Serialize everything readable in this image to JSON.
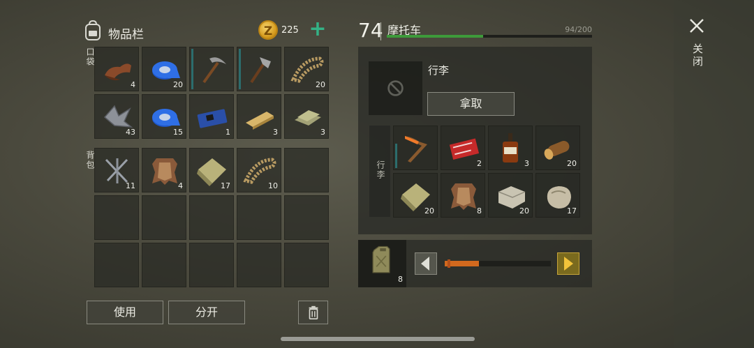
{
  "inventory": {
    "title": "物品栏",
    "coins": "225",
    "coin_symbol": "Z",
    "add_coins": "+",
    "pockets_label": "口袋",
    "backpack_label": "背包",
    "pockets": [
      {
        "item": "leather-icon",
        "count": "4"
      },
      {
        "item": "duct-tape-icon",
        "count": "20"
      },
      {
        "item": "pickaxe-icon",
        "count": "",
        "durability": 1.0
      },
      {
        "item": "hatchet-icon",
        "count": "",
        "durability": 1.0
      },
      {
        "item": "rope-icon",
        "count": "20"
      },
      {
        "item": "scrap-metal-icon",
        "count": "43"
      },
      {
        "item": "duct-tape-icon",
        "count": "15"
      },
      {
        "item": "circuit-board-icon",
        "count": "1"
      },
      {
        "item": "wood-plank-icon",
        "count": "3"
      },
      {
        "item": "cloth-icon",
        "count": "3"
      }
    ],
    "backpack": [
      {
        "item": "nails-icon",
        "count": "11"
      },
      {
        "item": "hide-icon",
        "count": "4"
      },
      {
        "item": "burlap-sack-icon",
        "count": "17"
      },
      {
        "item": "rope-icon",
        "count": "10"
      },
      {
        "item": "",
        "count": ""
      },
      {
        "item": "",
        "count": ""
      },
      {
        "item": "",
        "count": ""
      },
      {
        "item": "",
        "count": ""
      },
      {
        "item": "",
        "count": ""
      },
      {
        "item": "",
        "count": ""
      },
      {
        "item": "",
        "count": ""
      },
      {
        "item": "",
        "count": ""
      },
      {
        "item": "",
        "count": ""
      },
      {
        "item": "",
        "count": ""
      },
      {
        "item": "",
        "count": ""
      }
    ],
    "use_button": "使用",
    "split_button": "分开"
  },
  "vehicle": {
    "level": "74",
    "name": "摩托车",
    "capacity_text": "94/200",
    "capacity_fraction": 0.47,
    "luggage_title": "行李",
    "take_button": "拿取",
    "luggage_label": "行李",
    "luggage": [
      {
        "item": "hockey-stick-icon",
        "count": "",
        "durability": 0.6
      },
      {
        "item": "coupon-icon",
        "count": "2"
      },
      {
        "item": "whiskey-bottle-icon",
        "count": "3"
      },
      {
        "item": "log-icon",
        "count": "20"
      },
      {
        "item": "burlap-sack-icon",
        "count": "20"
      },
      {
        "item": "hide-icon",
        "count": "8"
      },
      {
        "item": "stone-block-icon",
        "count": "20"
      },
      {
        "item": "limestone-icon",
        "count": "17"
      }
    ],
    "fuel": {
      "count": "8",
      "level_fraction": 0.32
    }
  },
  "close_label": "关闭",
  "colors": {
    "accent_green": "#3d9a3a",
    "fuel_orange": "#d2691e",
    "coin_gold": "#d49a1c",
    "teal": "#34b286"
  }
}
